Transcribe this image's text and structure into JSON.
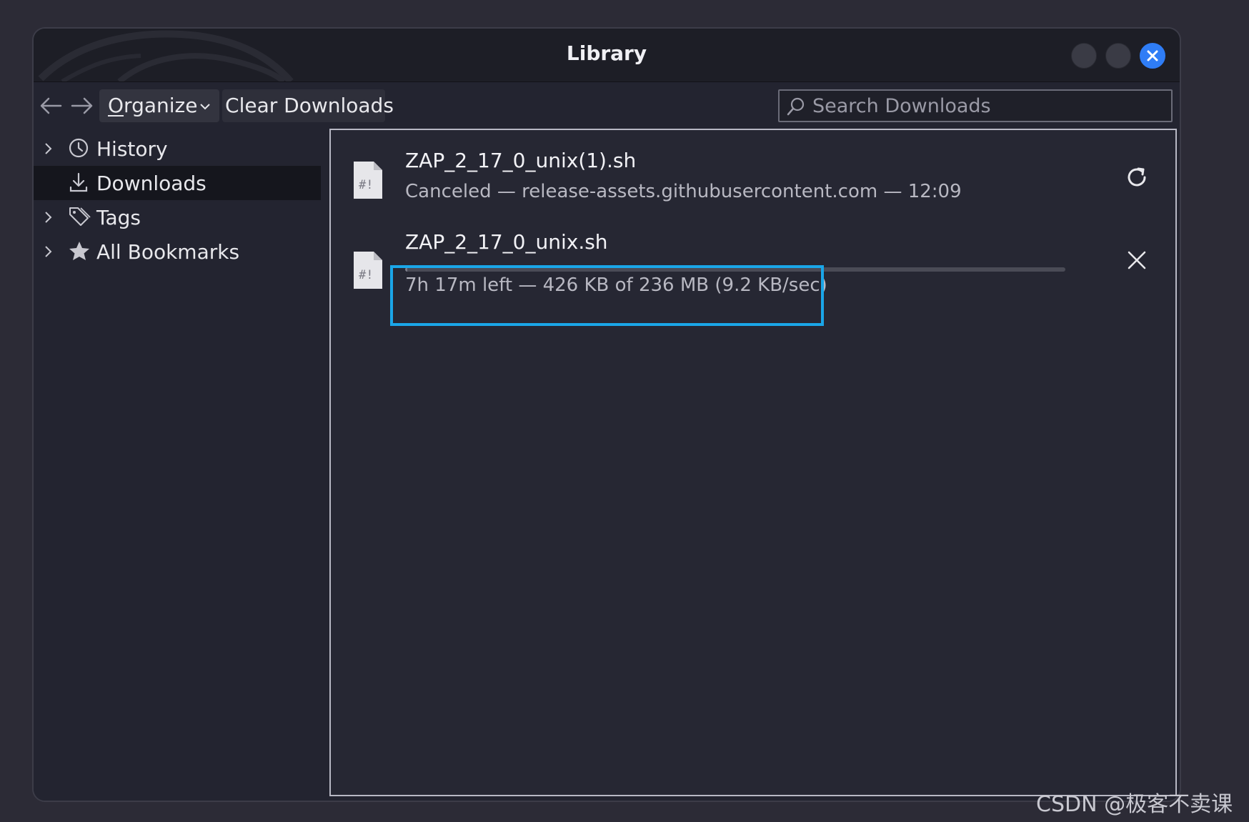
{
  "window": {
    "title": "Library"
  },
  "toolbar": {
    "organize_first": "O",
    "organize_rest": "rganize",
    "clear_first": "C",
    "clear_rest": "lear Downloads",
    "search_placeholder": "Search Downloads"
  },
  "sidebar": {
    "items": [
      {
        "label": "History",
        "icon": "clock-icon",
        "expandable": true,
        "selected": false
      },
      {
        "label": "Downloads",
        "icon": "download-icon",
        "expandable": false,
        "selected": true
      },
      {
        "label": "Tags",
        "icon": "tag-icon",
        "expandable": true,
        "selected": false
      },
      {
        "label": "All Bookmarks",
        "icon": "star-icon",
        "expandable": true,
        "selected": false
      }
    ]
  },
  "downloads": [
    {
      "name": "ZAP_2_17_0_unix(1).sh",
      "status": "Canceled — release-assets.githubusercontent.com — 12:09",
      "action": "retry-icon"
    },
    {
      "name": "ZAP_2_17_0_unix.sh",
      "status": "7h 17m left — 426 KB of 236 MB (9.2 KB/sec)",
      "progress_fraction": 0.0018,
      "action": "cancel-icon"
    }
  ],
  "colors": {
    "accent_close": "#2f7df6",
    "highlight": "#1aa6e8"
  },
  "watermark": "CSDN @极客不卖课"
}
